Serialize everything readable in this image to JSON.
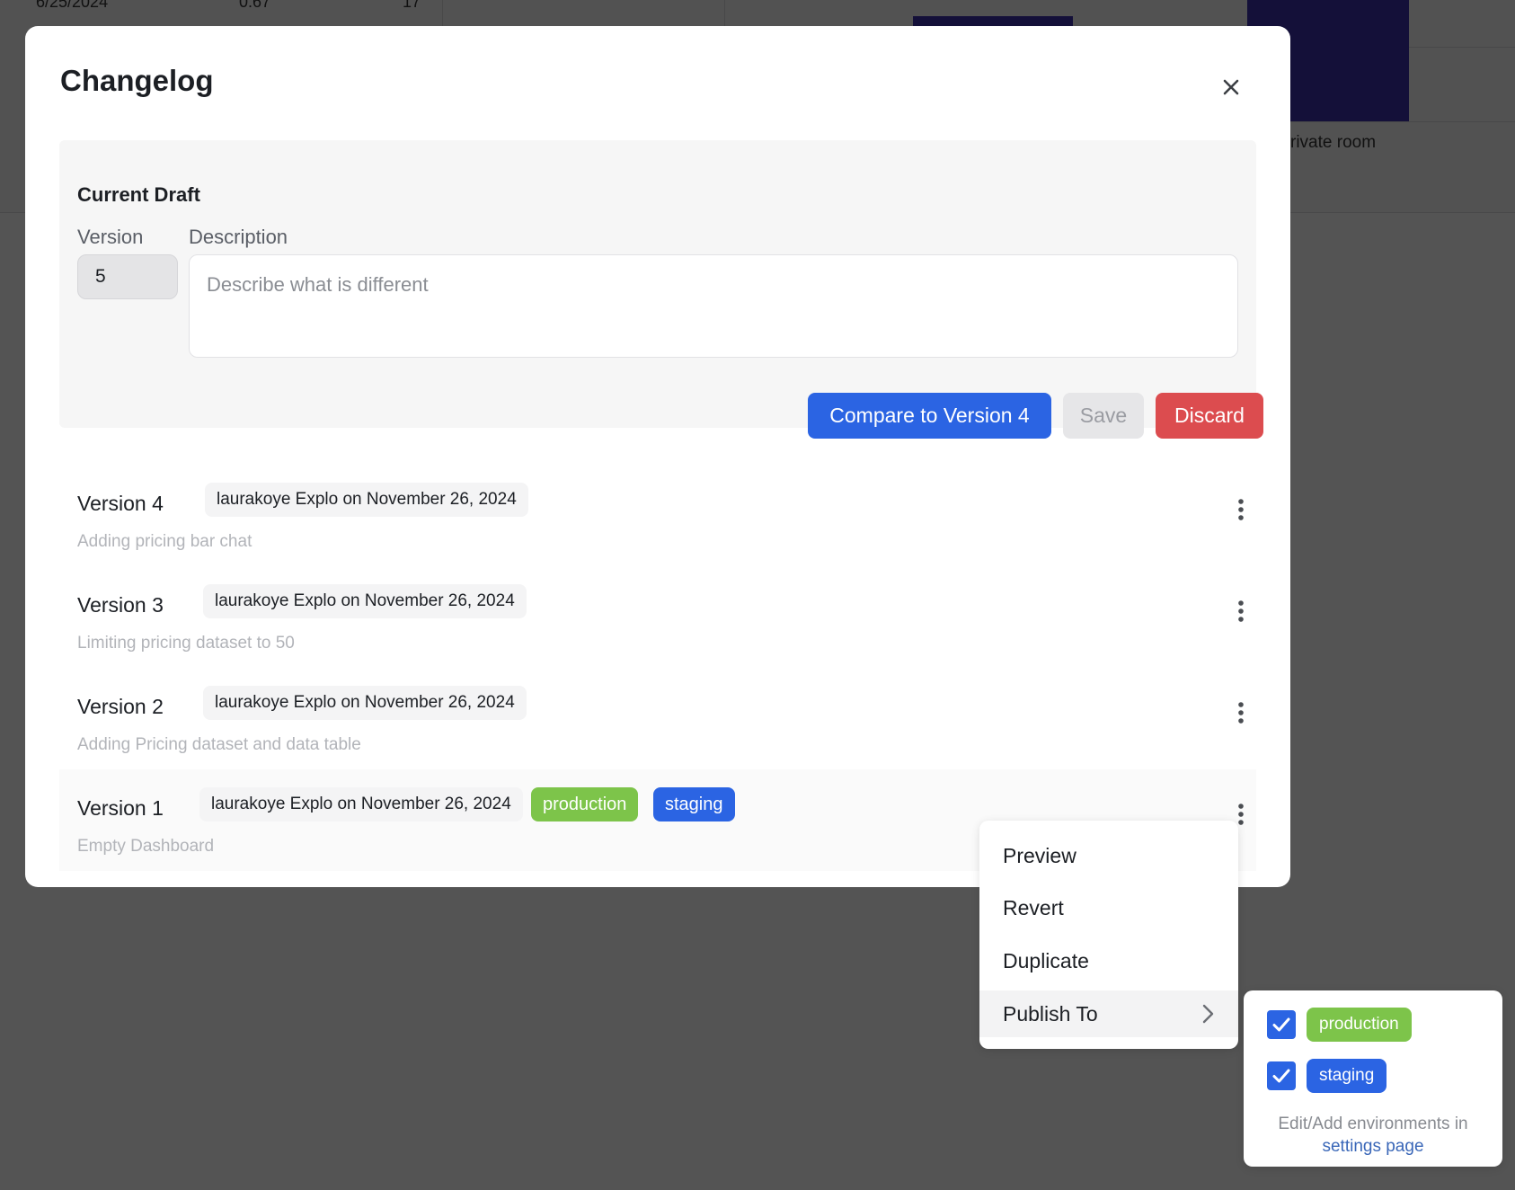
{
  "background": {
    "cells": [
      "6/25/2024",
      "0.67",
      "17"
    ],
    "axis_label": "rivate room",
    "bar_color": "#3a2fa8"
  },
  "modal": {
    "title": "Changelog",
    "close_icon": "close-icon",
    "draft": {
      "heading": "Current Draft",
      "version_label": "Version",
      "version_value": "5",
      "description_label": "Description",
      "description_value": "",
      "description_placeholder": "Describe what is different",
      "compare_label": "Compare to Version 4",
      "save_label": "Save",
      "discard_label": "Discard"
    },
    "versions": [
      {
        "name": "Version 4",
        "author": "laurakoye Explo on November 26, 2024",
        "description": "Adding pricing bar chat"
      },
      {
        "name": "Version 3",
        "author": "laurakoye Explo on November 26, 2024",
        "description": "Limiting pricing dataset to 50"
      },
      {
        "name": "Version 2",
        "author": "laurakoye Explo on November 26, 2024",
        "description": "Adding Pricing dataset and data table"
      },
      {
        "name": "Version 1",
        "author": "laurakoye Explo on November 26, 2024",
        "description": "Empty Dashboard",
        "environments": [
          "production",
          "staging"
        ]
      }
    ]
  },
  "menu": {
    "items": [
      "Preview",
      "Revert",
      "Duplicate",
      "Publish To"
    ],
    "active_item": "Publish To"
  },
  "publish_submenu": {
    "environments": [
      {
        "name": "production",
        "checked": true,
        "color": "#7dc44a"
      },
      {
        "name": "staging",
        "checked": true,
        "color": "#2b64e3"
      }
    ],
    "help_text": "Edit/Add environments in",
    "help_link": "settings page"
  },
  "colors": {
    "primary": "#2b64e3",
    "danger": "#dc4c4f",
    "production": "#7dc44a",
    "staging": "#2b64e3"
  }
}
